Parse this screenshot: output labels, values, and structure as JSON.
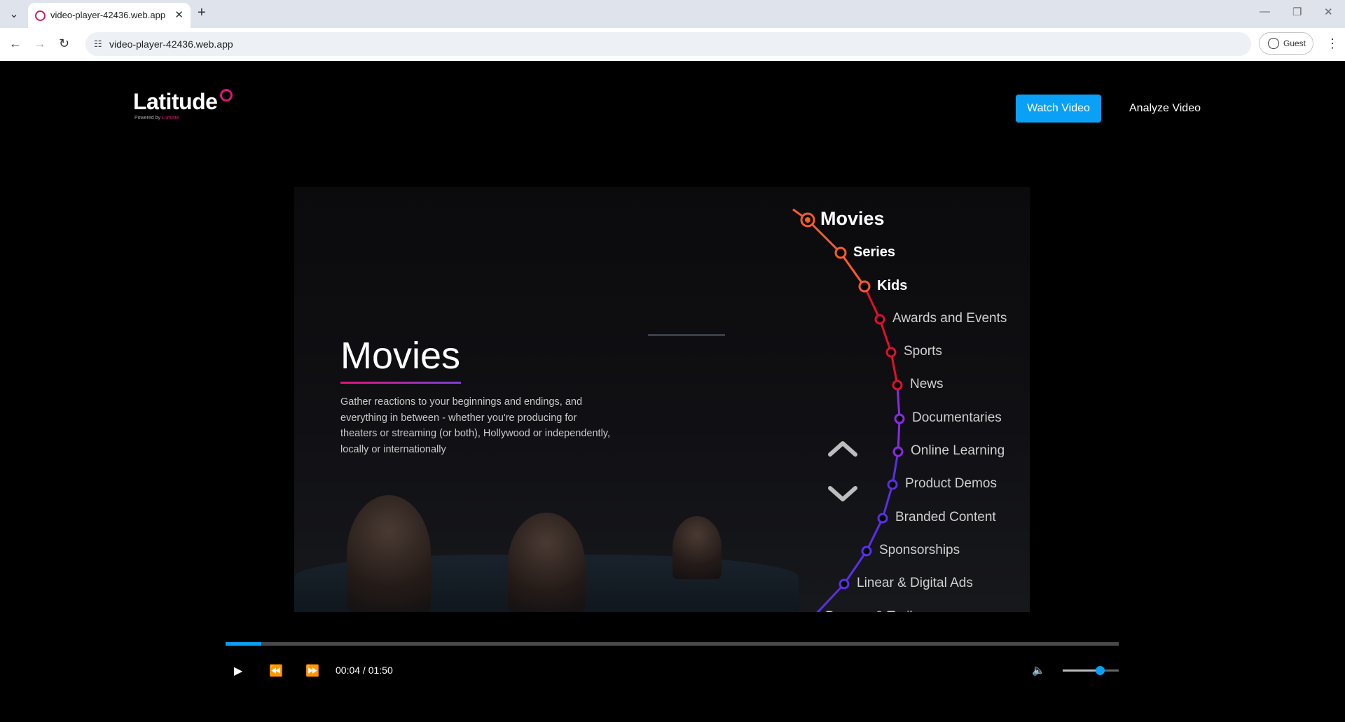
{
  "browser": {
    "tab_title": "video-player-42436.web.app",
    "url": "video-player-42436.web.app",
    "profile_label": "Guest"
  },
  "header": {
    "logo_text": "Latitude",
    "powered_by_prefix": "Powered by",
    "powered_by_brand": "Lumiste",
    "watch_label": "Watch Video",
    "analyze_label": "Analyze Video"
  },
  "video": {
    "heading": "Movies",
    "description": "Gather reactions to your beginnings and endings, and everything in between - whether you're producing for theaters or streaming (or both), Hollywood or independently, locally or internationally",
    "categories": [
      {
        "label": "Movies",
        "color": "#ff5a2a"
      },
      {
        "label": "Series",
        "color": "#ff5a2a"
      },
      {
        "label": "Kids",
        "color": "#ff5a2a"
      },
      {
        "label": "Awards and Events",
        "color": "#e0102a"
      },
      {
        "label": "Sports",
        "color": "#e0102a"
      },
      {
        "label": "News",
        "color": "#e0102a"
      },
      {
        "label": "Documentaries",
        "color": "#8a2be2"
      },
      {
        "label": "Online Learning",
        "color": "#8a2be2"
      },
      {
        "label": "Product Demos",
        "color": "#5b2ee8"
      },
      {
        "label": "Branded Content",
        "color": "#5b2ee8"
      },
      {
        "label": "Sponsorships",
        "color": "#5b2ee8"
      },
      {
        "label": "Linear & Digital Ads",
        "color": "#5b2ee8"
      },
      {
        "label": "Promos & Trailers",
        "color": "#5b2ee8"
      }
    ]
  },
  "controls": {
    "current_time": "00:04",
    "duration": "01:50",
    "time_display": "00:04 / 01:50",
    "progress_fraction": 0.04,
    "volume_fraction": 0.66,
    "accent_color": "#0aa0f5"
  }
}
